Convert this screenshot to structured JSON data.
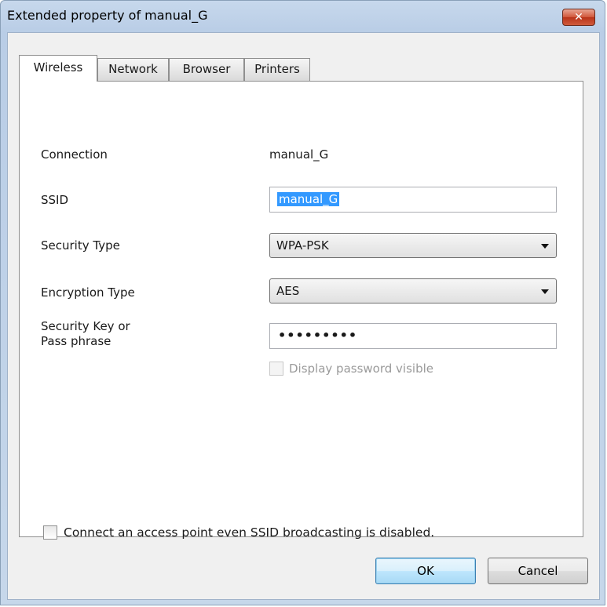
{
  "window": {
    "title": "Extended property of manual_G",
    "close_glyph": "✕"
  },
  "tabs": [
    {
      "label": "Wireless",
      "active": true
    },
    {
      "label": "Network",
      "active": false
    },
    {
      "label": "Browser",
      "active": false
    },
    {
      "label": "Printers",
      "active": false
    }
  ],
  "form": {
    "connection_label": "Connection",
    "connection_value": "manual_G",
    "ssid_label": "SSID",
    "ssid_value": "manual_G",
    "security_type_label": "Security Type",
    "security_type_value": "WPA-PSK",
    "encryption_type_label": "Encryption Type",
    "encryption_type_value": "AES",
    "security_key_label_line1": "Security Key or",
    "security_key_label_line2": "Pass phrase",
    "security_key_masked": "•••••••••",
    "display_password_label": "Display password visible",
    "broadcast_label": "Connect an access point even SSID broadcasting is disabled."
  },
  "buttons": {
    "ok_label": "OK",
    "cancel_label": "Cancel"
  },
  "colors": {
    "selection": "#3399ff",
    "close_button": "#c9442a"
  }
}
